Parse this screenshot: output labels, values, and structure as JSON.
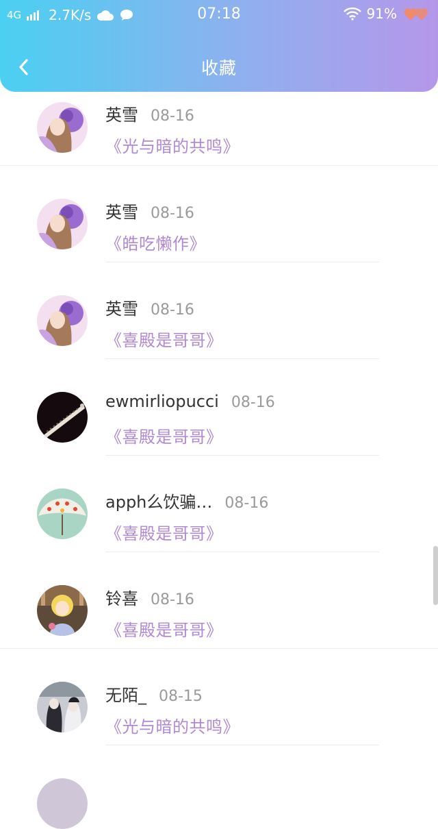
{
  "status_bar": {
    "network": "4G",
    "speed": "2.7K/s",
    "time": "07:18",
    "battery": "91%"
  },
  "header": {
    "title": "收藏"
  },
  "favorites": [
    {
      "user": "英雪",
      "date": "08-16",
      "work": "《光与暗的共鸣》",
      "avatar": "purple-girl"
    },
    {
      "user": "英雪",
      "date": "08-16",
      "work": "《皓吃懒作》",
      "avatar": "purple-girl"
    },
    {
      "user": "英雪",
      "date": "08-16",
      "work": "《喜殿是哥哥》",
      "avatar": "purple-girl"
    },
    {
      "user": "ewmirliopucci",
      "date": "08-16",
      "work": "《喜殿是哥哥》",
      "avatar": "dark-spiral"
    },
    {
      "user": "apph么饮骗…",
      "date": "08-16",
      "work": "《喜殿是哥哥》",
      "avatar": "flower-umbrella"
    },
    {
      "user": "铃喜",
      "date": "08-16",
      "work": "《喜殿是哥哥》",
      "avatar": "cartoon-kid"
    },
    {
      "user": "无陌_",
      "date": "08-15",
      "work": "《光与暗的共鸣》",
      "avatar": "ink-figures"
    }
  ],
  "colors": {
    "accent": "#b089d4",
    "header_start": "#4ad0f2",
    "header_end": "#b597ea"
  }
}
